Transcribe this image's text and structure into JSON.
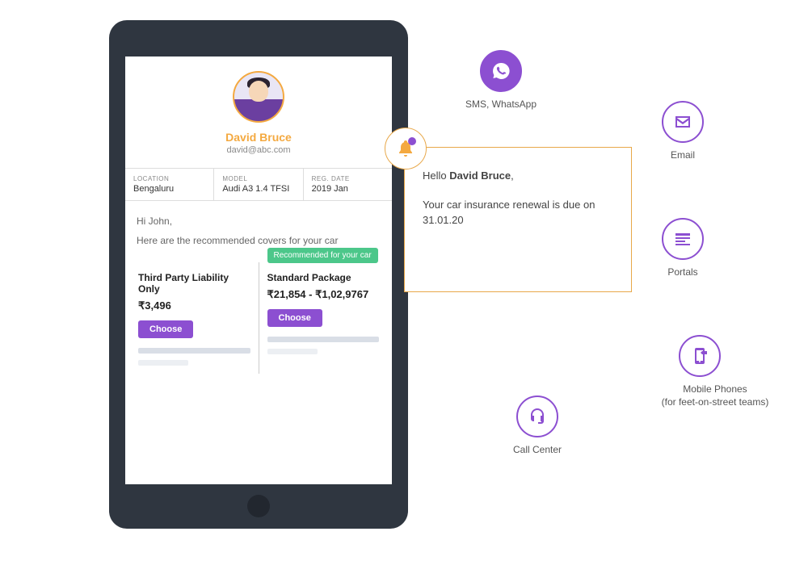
{
  "profile": {
    "name": "David Bruce",
    "email": "david@abc.com"
  },
  "info": {
    "location_label": "LOCATION",
    "location_value": "Bengaluru",
    "model_label": "MODEL",
    "model_value": "Audi A3 1.4 TFSI",
    "regdate_label": "REG. DATE",
    "regdate_value": "2019 Jan"
  },
  "message": {
    "greeting": "Hi John,",
    "body": "Here are the recommended covers for your car"
  },
  "packages": [
    {
      "title": "Third Party Liability Only",
      "price": "₹3,496",
      "choose": "Choose",
      "recommended": false,
      "badge": ""
    },
    {
      "title": "Standard Package",
      "price": "₹21,854 - ₹1,02,9767",
      "choose": "Choose",
      "recommended": true,
      "badge": "Recommended for your car"
    }
  ],
  "notification": {
    "hello": "Hello ",
    "name": "David Bruce",
    "comma": ",",
    "line2": "Your car insurance renewal is due on 31.01.20"
  },
  "channels": {
    "sms": "SMS, WhatsApp",
    "email": "Email",
    "portals": "Portals",
    "mobile": "Mobile Phones\n(for feet-on-street teams)",
    "call": "Call Center"
  },
  "colors": {
    "accent_purple": "#8c4fd1",
    "accent_orange": "#f4a940",
    "badge_green": "#4cc78a"
  }
}
